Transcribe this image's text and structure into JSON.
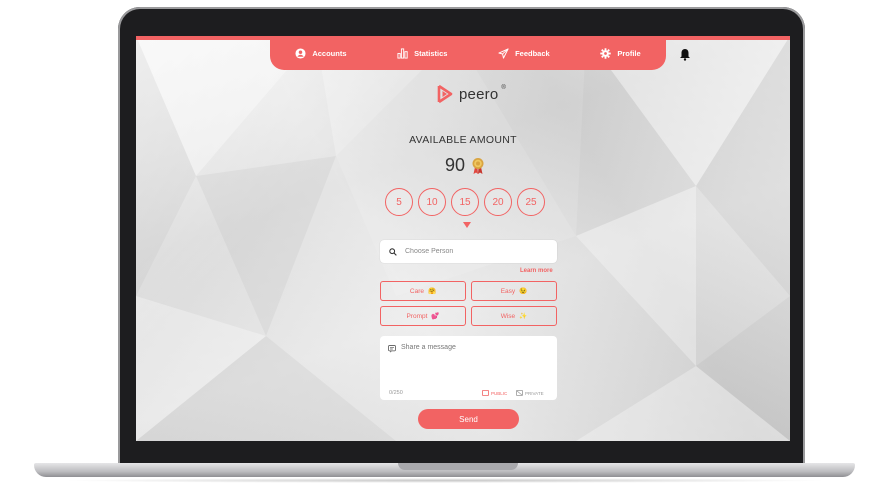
{
  "nav": {
    "items": [
      {
        "label": "Accounts",
        "icon": "user-circle-icon"
      },
      {
        "label": "Statistics",
        "icon": "bar-chart-icon"
      },
      {
        "label": "Feedback",
        "icon": "paper-plane-icon"
      },
      {
        "label": "Profile",
        "icon": "gear-icon"
      }
    ],
    "bell_icon": "bell-icon"
  },
  "brand": {
    "name": "peero",
    "mark": "®",
    "color": "#f26363"
  },
  "available": {
    "title": "AVAILABLE AMOUNT",
    "value": "90",
    "icon": "medal-icon"
  },
  "amount_options": [
    "5",
    "10",
    "15",
    "20",
    "25"
  ],
  "search": {
    "placeholder": "Choose Person"
  },
  "learn_more": "Learn more",
  "values_tags": [
    {
      "label": "Care",
      "emoji": "🤗"
    },
    {
      "label": "Easy",
      "emoji": "😉"
    },
    {
      "label": "Prompt",
      "emoji": "💕"
    },
    {
      "label": "Wise",
      "emoji": "✨"
    }
  ],
  "message": {
    "placeholder": "Share a message",
    "counter": "0/250",
    "public_label": "PUBLIC",
    "private_label": "PRIVATE"
  },
  "send_label": "Send",
  "colors": {
    "accent": "#f26363",
    "text": "#333333"
  }
}
